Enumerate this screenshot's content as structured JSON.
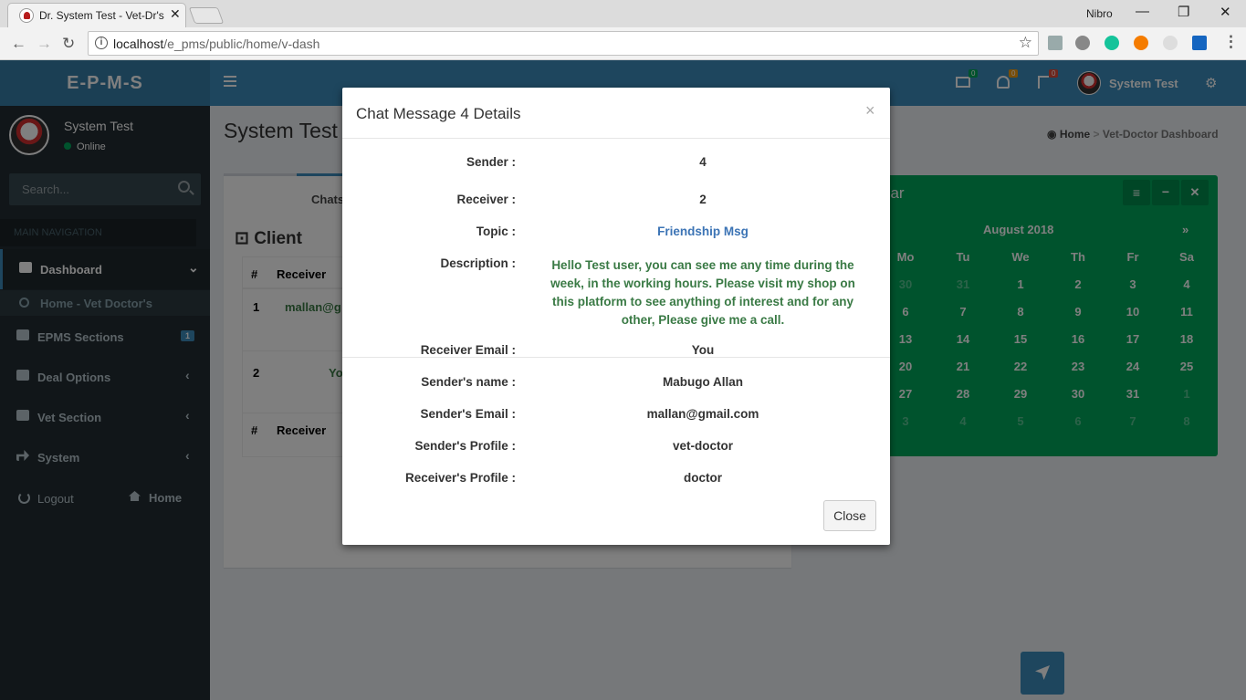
{
  "browser": {
    "tab_title": "Dr. System Test - Vet-Dr's",
    "tab_close": "✕",
    "window_user": "Nibro",
    "min_glyph": "—",
    "max_glyph": "❐",
    "close_glyph": "✕",
    "back": "←",
    "forward": "→",
    "reload": "↻",
    "url_host": "localhost",
    "url_path": "/e_pms/public/home/v-dash",
    "star": "☆"
  },
  "app": {
    "logo": "E-P-M-S",
    "user_name": "System Test",
    "online": "Online",
    "search_placeholder": "Search...",
    "nav_header": "MAIN NAVIGATION",
    "menu": [
      {
        "label": "Dashboard",
        "chevron": "⌄"
      },
      {
        "label": "Home - Vet Doctor's"
      },
      {
        "label": "EPMS Sections",
        "badge": "1"
      },
      {
        "label": "Deal Options",
        "chevron": "‹"
      },
      {
        "label": "Vet Section",
        "chevron": "‹"
      },
      {
        "label": "System",
        "chevron": "‹"
      }
    ],
    "logout": "Logout",
    "home": "Home",
    "top_user": "System Test",
    "badges": {
      "mail": "0",
      "bell": "0",
      "flag": "0"
    }
  },
  "page": {
    "title": "System Test |",
    "breadcrumb_home": "Home",
    "breadcrumb_sep": ">",
    "breadcrumb_current": "Vet-Doctor Dashboard",
    "tab_label": "Chats",
    "box_title": "Client",
    "table": {
      "headers": [
        "#",
        "Receiver"
      ],
      "rows": [
        {
          "num": "1",
          "receiver": "mallan@g"
        },
        {
          "num": "2",
          "receiver": "Yo"
        }
      ]
    }
  },
  "calendar": {
    "title": "dar",
    "month": "August 2018",
    "next": "»",
    "days": [
      "Mo",
      "Tu",
      "We",
      "Th",
      "Fr",
      "Sa"
    ],
    "weeks": [
      [
        "30",
        "31",
        "1",
        "2",
        "3",
        "4"
      ],
      [
        "6",
        "7",
        "8",
        "9",
        "10",
        "11"
      ],
      [
        "13",
        "14",
        "15",
        "16",
        "17",
        "18"
      ],
      [
        "20",
        "21",
        "22",
        "23",
        "24",
        "25"
      ],
      [
        "27",
        "28",
        "29",
        "30",
        "31",
        "1"
      ],
      [
        "3",
        "4",
        "5",
        "6",
        "7",
        "8"
      ]
    ]
  },
  "modal": {
    "title": "Chat Message 4 Details",
    "close_x": "×",
    "fields": [
      {
        "label": "Sender :",
        "value": "4"
      },
      {
        "label": "Receiver :",
        "value": "2"
      },
      {
        "label": "Topic :",
        "value": "Friendship Msg"
      },
      {
        "label": "Description :",
        "value": "Hello Test user, you can see me any time during the week, in the working hours. Please visit my shop on this platform to see anything of interest and for any other, Please give me a call."
      },
      {
        "label": "Receiver Email :",
        "value": "You"
      },
      {
        "label": "Sender's name :",
        "value": "Mabugo Allan"
      },
      {
        "label": "Sender's Email :",
        "value": "mallan@gmail.com"
      },
      {
        "label": "Sender's Profile :",
        "value": "vet-doctor"
      },
      {
        "label": "Receiver's Profile :",
        "value": "doctor"
      }
    ],
    "close_button": "Close"
  },
  "colors": {
    "sidebar": "#222d32",
    "header": "#3c8dbc",
    "calendar": "#00a65a",
    "topic_link": "#3c74b5",
    "description": "#3a7a45"
  }
}
